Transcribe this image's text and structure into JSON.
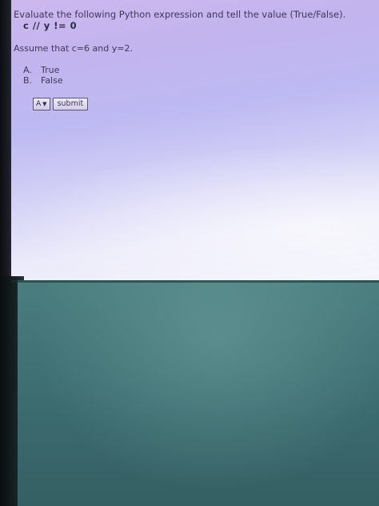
{
  "question": {
    "prompt": "Evaluate the following Python expression and tell the value (True/False).",
    "expression": "c // y != 0",
    "assumption": "Assume that c=6 and y=2."
  },
  "options": [
    {
      "letter": "A.",
      "label": "True"
    },
    {
      "letter": "B.",
      "label": "False"
    }
  ],
  "answer_select": {
    "selected": "A",
    "caret_icon": "chevron-down-icon"
  },
  "submit_label": "submit"
}
